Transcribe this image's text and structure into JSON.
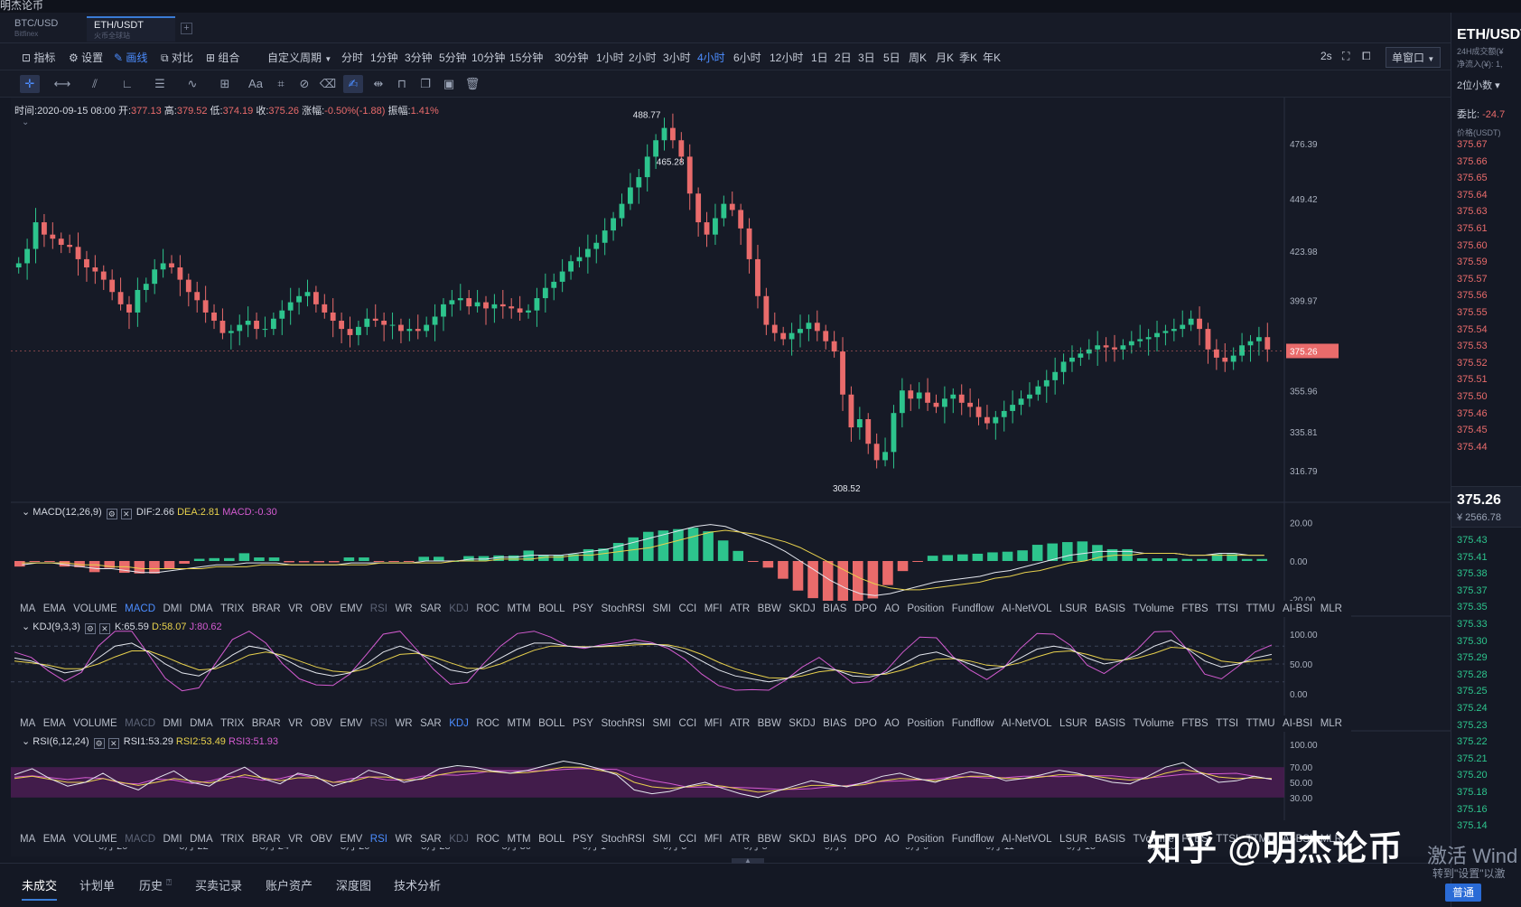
{
  "app": {
    "title": "明杰论币"
  },
  "tabs": [
    {
      "label": "BTC/USD",
      "sub": "Bitfinex"
    },
    {
      "label": "ETH/USDT",
      "sub": "火币全球站"
    }
  ],
  "add_tab": "+",
  "toolbar": {
    "indicator": "指标",
    "settings": "设置",
    "draw": "画线",
    "compare": "对比",
    "combo": "组合",
    "custom_period": "自定义周期",
    "refresh": "2s",
    "window_mode": "单窗口"
  },
  "periods": [
    "分时",
    "1分钟",
    "3分钟",
    "5分钟",
    "10分钟",
    "15分钟",
    "30分钟",
    "1小时",
    "2小时",
    "3小时",
    "4小时",
    "6小时",
    "12小时",
    "1日",
    "2日",
    "3日",
    "5日",
    "周K",
    "月K",
    "季K",
    "年K"
  ],
  "active_period": "4小时",
  "draw_tools": [
    "crosshair-icon",
    "hline-icon",
    "trend-lines-icon",
    "angle-icon",
    "parallel-icon",
    "wave-icon",
    "grid-icon",
    "text-tool-icon",
    "fib-icon",
    "brush-icon",
    "eraser-icon",
    "draw-mode-icon",
    "measure-icon",
    "lock-icon",
    "copy-icon",
    "screenshot-icon",
    "trash-icon"
  ],
  "ohlc": {
    "time_label": "时间:",
    "time": "2020-09-15 08:00",
    "open_label": "开:",
    "open": "377.13",
    "high_label": "高:",
    "high": "379.52",
    "low_label": "低:",
    "low": "374.19",
    "close_label": "收:",
    "close": "375.26",
    "chg_label": "涨幅:",
    "chg": "-0.50%(-1.88)",
    "amp_label": "振幅:",
    "amp": "1.41%"
  },
  "price_axis": [
    "476.39",
    "449.42",
    "423.98",
    "399.97",
    "375.26",
    "355.96",
    "335.81",
    "316.79"
  ],
  "current_price": "375.26",
  "annotations": {
    "high": "488.77",
    "high2": "465.28",
    "low": "308.52"
  },
  "macd": {
    "title": "MACD(12,26,9)",
    "dif": "DIF:2.66",
    "dea": "DEA:2.81",
    "macd": "MACD:-0.30",
    "axis": [
      "20.00",
      "0.00",
      "-20.00"
    ]
  },
  "kdj": {
    "title": "KDJ(9,3,3)",
    "k": "K:65.59",
    "d": "D:58.07",
    "j": "J:80.62",
    "axis": [
      "100.00",
      "50.00",
      "0.00"
    ]
  },
  "rsi": {
    "title": "RSI(6,12,24)",
    "rsi1": "RSI1:53.29",
    "rsi2": "RSI2:53.49",
    "rsi3": "RSI3:51.93",
    "axis": [
      "100.00",
      "70.00",
      "50.00",
      "30.00"
    ]
  },
  "indicator_list": [
    "MA",
    "EMA",
    "VOLUME",
    "MACD",
    "DMI",
    "DMA",
    "TRIX",
    "BRAR",
    "VR",
    "OBV",
    "EMV",
    "RSI",
    "WR",
    "SAR",
    "KDJ",
    "ROC",
    "MTM",
    "BOLL",
    "PSY",
    "StochRSI",
    "SMI",
    "CCI",
    "MFI",
    "ATR",
    "BBW",
    "SKDJ",
    "BIAS",
    "DPO",
    "AO",
    "Position",
    "Fundflow",
    "AI-NetVOL",
    "LSUR",
    "BASIS",
    "TVolume",
    "FTBS",
    "TTSI",
    "TTMU",
    "AI-BSI",
    "MLR"
  ],
  "time_axis": [
    "8月 20",
    "8月 22",
    "8月 24",
    "8月 26",
    "8月 28",
    "8月 30",
    "9月 1",
    "9月 3",
    "9月 5",
    "9月 7",
    "9月 9",
    "9月 11",
    "9月 13",
    "9月 15"
  ],
  "bottom_tabs": [
    "未成交",
    "计划单",
    "历史",
    "买卖记录",
    "账户资产",
    "深度图",
    "技术分析"
  ],
  "right_panel": {
    "symbol": "ETH/USDT",
    "vol_label": "24H成交额(¥",
    "inflow_label": "净流入(¥): 1,",
    "decimals": "2位小数",
    "ratio_label": "委比:",
    "ratio": "-24.7",
    "price_col": "价格(USDT)",
    "asks": [
      "375.67",
      "375.66",
      "375.65",
      "375.64",
      "375.63",
      "375.61",
      "375.60",
      "375.59",
      "375.57",
      "375.56",
      "375.55",
      "375.54",
      "375.53",
      "375.52",
      "375.51",
      "375.50",
      "375.46",
      "375.45",
      "375.44"
    ],
    "last": "375.26",
    "last_cny": "¥ 2566.78",
    "bids": [
      "375.43",
      "375.41",
      "375.38",
      "375.37",
      "375.35",
      "375.33",
      "375.30",
      "375.29",
      "375.28",
      "375.25",
      "375.24",
      "375.23",
      "375.22",
      "375.21",
      "375.20",
      "375.18",
      "375.16",
      "375.14"
    ]
  },
  "watermark": "知乎 @明杰论币",
  "windows_watermark": "激活 Wind",
  "windows_hint": "转到\"设置\"以激",
  "mode_badge": "普通",
  "chart_data": {
    "type": "candlestick",
    "symbol": "ETH/USDT",
    "interval": "4小时",
    "closes": [
      418,
      425,
      438,
      432,
      430,
      427,
      426,
      420,
      416,
      414,
      410,
      404,
      398,
      394,
      405,
      408,
      415,
      418,
      416,
      410,
      404,
      400,
      394,
      390,
      384,
      385,
      388,
      390,
      386,
      386,
      391,
      395,
      399,
      402,
      404,
      398,
      394,
      390,
      386,
      383,
      387,
      391,
      390,
      388,
      388,
      385,
      386,
      385,
      388,
      392,
      398,
      400,
      401,
      397,
      399,
      396,
      398,
      397,
      396,
      394,
      395,
      401,
      406,
      409,
      414,
      419,
      421,
      425,
      428,
      434,
      440,
      447,
      455,
      460,
      470,
      478,
      484,
      478,
      470,
      452,
      438,
      432,
      440,
      447,
      444,
      435,
      420,
      402,
      388,
      384,
      381,
      384,
      386,
      389,
      385,
      380,
      375,
      354,
      338,
      342,
      330,
      322,
      326,
      345,
      356,
      352,
      355,
      350,
      348,
      352,
      354,
      350,
      348,
      343,
      340,
      343,
      346,
      349,
      352,
      354,
      358,
      361,
      365,
      370,
      372,
      374,
      376,
      378,
      377,
      376,
      378,
      380,
      381,
      382,
      384,
      385,
      386,
      388,
      391,
      386,
      376,
      372,
      370,
      373,
      378,
      380,
      382,
      376
    ]
  },
  "macd_series": {
    "dif": [
      -2,
      -1,
      -1,
      -2,
      -3,
      -4,
      -4,
      -5,
      -6,
      -6,
      -5,
      -4,
      -3,
      -2,
      -2,
      -1,
      -1,
      -1,
      -2,
      -2,
      -2,
      -2,
      -1,
      -1,
      -1,
      -1,
      -1,
      0,
      0,
      0,
      1,
      1,
      2,
      2,
      3,
      3,
      3,
      4,
      5,
      6,
      8,
      10,
      12,
      14,
      16,
      18,
      19,
      18,
      15,
      12,
      9,
      5,
      0,
      -5,
      -10,
      -14,
      -17,
      -18,
      -17,
      -15,
      -13,
      -11,
      -10,
      -9,
      -8,
      -6,
      -5,
      -3,
      -1,
      1,
      3,
      4,
      5,
      5,
      5,
      4,
      4,
      4,
      3,
      3,
      4,
      4,
      3,
      3
    ],
    "dea": [
      -1,
      -1,
      -1,
      -1,
      -2,
      -2,
      -3,
      -3,
      -4,
      -4,
      -4,
      -4,
      -4,
      -3,
      -3,
      -3,
      -2,
      -2,
      -2,
      -2,
      -2,
      -2,
      -2,
      -2,
      -1,
      -1,
      -1,
      -1,
      -1,
      0,
      0,
      0,
      1,
      1,
      1,
      2,
      2,
      3,
      3,
      4,
      5,
      6,
      7,
      9,
      11,
      13,
      15,
      16,
      15,
      14,
      12,
      10,
      7,
      3,
      -1,
      -5,
      -9,
      -12,
      -14,
      -15,
      -15,
      -14,
      -13,
      -12,
      -11,
      -9,
      -8,
      -6,
      -5,
      -3,
      -1,
      0,
      2,
      3,
      3,
      4,
      4,
      4,
      3,
      3,
      3,
      3,
      3,
      3
    ]
  },
  "kdj_series": {
    "k": [
      60,
      55,
      45,
      35,
      40,
      60,
      80,
      85,
      70,
      50,
      35,
      30,
      45,
      65,
      80,
      75,
      60,
      45,
      35,
      30,
      35,
      50,
      70,
      80,
      70,
      55,
      40,
      35,
      45,
      60,
      75,
      85,
      85,
      80,
      78,
      80,
      82,
      85,
      84,
      80,
      70,
      55,
      40,
      30,
      25,
      20,
      25,
      35,
      45,
      40,
      30,
      28,
      35,
      50,
      65,
      70,
      60,
      50,
      40,
      45,
      60,
      75,
      80,
      75,
      60,
      50,
      55,
      65,
      80,
      90,
      75,
      55,
      45,
      50,
      60,
      66
    ],
    "d": [
      55,
      52,
      48,
      42,
      42,
      50,
      62,
      72,
      72,
      62,
      50,
      40,
      42,
      52,
      65,
      70,
      65,
      55,
      45,
      38,
      36,
      42,
      55,
      66,
      68,
      62,
      52,
      43,
      42,
      50,
      62,
      73,
      80,
      80,
      79,
      79,
      80,
      82,
      83,
      82,
      76,
      66,
      53,
      42,
      34,
      27,
      26,
      30,
      37,
      40,
      36,
      32,
      33,
      40,
      50,
      58,
      59,
      55,
      48,
      46,
      52,
      62,
      70,
      72,
      66,
      58,
      56,
      60,
      68,
      78,
      76,
      66,
      55,
      52,
      55,
      58
    ]
  },
  "rsi_series": {
    "r1": [
      60,
      68,
      55,
      45,
      50,
      62,
      48,
      40,
      55,
      65,
      50,
      45,
      60,
      70,
      55,
      48,
      62,
      58,
      45,
      52,
      66,
      60,
      50,
      55,
      68,
      72,
      70,
      65,
      62,
      66,
      72,
      78,
      74,
      68,
      60,
      40,
      35,
      38,
      45,
      50,
      42,
      35,
      30,
      38,
      45,
      52,
      48,
      44,
      50,
      58,
      62,
      55,
      50,
      58,
      64,
      60,
      52,
      55,
      60,
      66,
      62,
      56,
      50,
      48,
      58,
      70,
      76,
      62,
      50,
      52,
      58,
      54
    ],
    "r2": [
      55,
      58,
      54,
      50,
      50,
      55,
      50,
      46,
      50,
      55,
      52,
      49,
      54,
      60,
      56,
      52,
      56,
      56,
      50,
      51,
      57,
      57,
      53,
      54,
      60,
      64,
      65,
      64,
      62,
      63,
      66,
      70,
      70,
      66,
      62,
      50,
      44,
      42,
      44,
      47,
      45,
      41,
      37,
      39,
      42,
      46,
      46,
      45,
      47,
      52,
      55,
      54,
      52,
      55,
      58,
      58,
      55,
      55,
      57,
      60,
      60,
      58,
      55,
      53,
      55,
      62,
      67,
      63,
      57,
      55,
      56,
      55
    ]
  }
}
